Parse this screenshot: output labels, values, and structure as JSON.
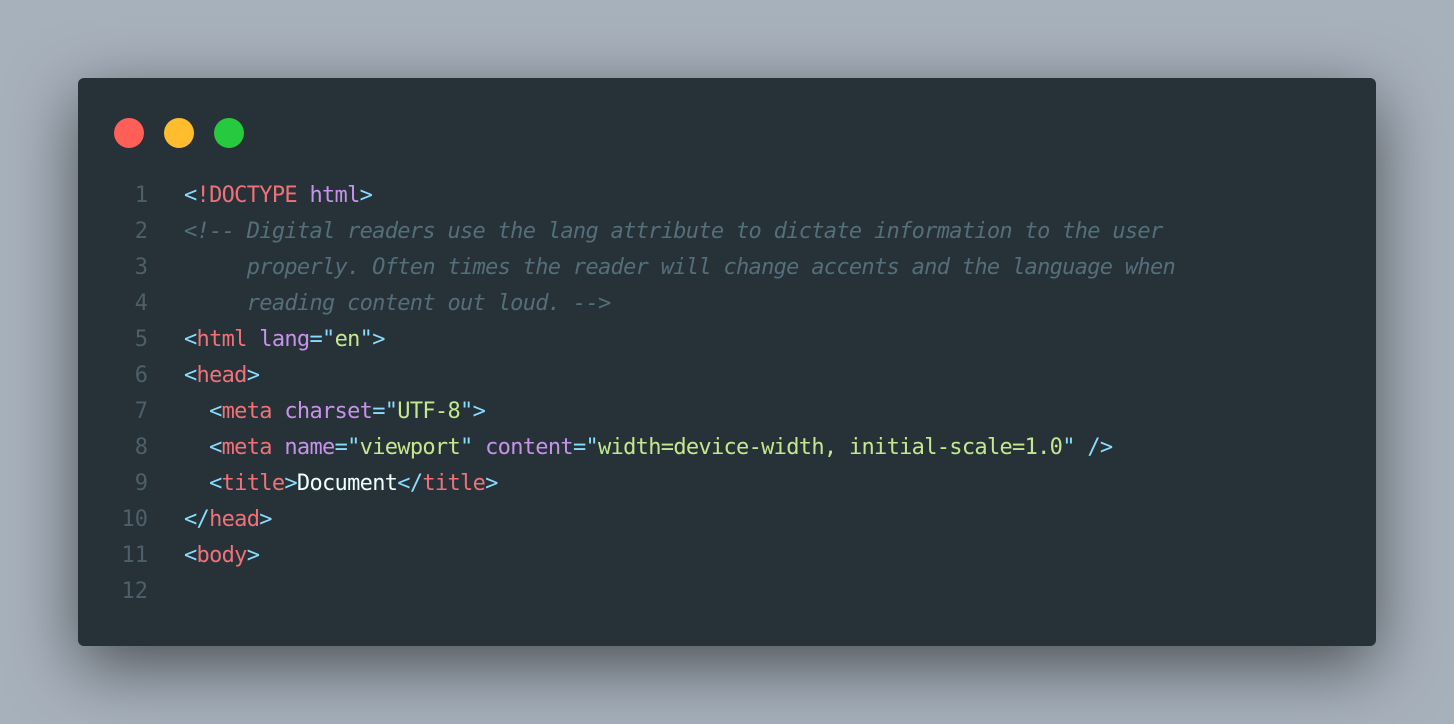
{
  "colors": {
    "background": "#a7b1bc",
    "window": "#263238",
    "close": "#ff5f56",
    "minimize": "#ffbd2e",
    "zoom": "#27c93f",
    "punctuation": "#89ddff",
    "tag": "#f07178",
    "attribute": "#c792ea",
    "string": "#c3e88d",
    "comment": "#546e7a",
    "text": "#eeffff"
  },
  "window_controls": [
    "close-button",
    "minimize-button",
    "zoom-button"
  ],
  "code": {
    "lines": [
      {
        "number": "1",
        "tokens": [
          {
            "type": "p",
            "text": "<"
          },
          {
            "type": "t",
            "text": "!DOCTYPE"
          },
          {
            "type": "w",
            "text": " "
          },
          {
            "type": "a",
            "text": "html"
          },
          {
            "type": "p",
            "text": ">"
          }
        ]
      },
      {
        "number": "2",
        "tokens": [
          {
            "type": "c",
            "text": "<!-- Digital readers use the lang attribute to dictate information to the user"
          }
        ]
      },
      {
        "number": "3",
        "tokens": [
          {
            "type": "c",
            "text": "     properly. Often times the reader will change accents and the language when"
          }
        ]
      },
      {
        "number": "4",
        "tokens": [
          {
            "type": "c",
            "text": "     reading content out loud. -->"
          }
        ]
      },
      {
        "number": "5",
        "tokens": [
          {
            "type": "p",
            "text": "<"
          },
          {
            "type": "t",
            "text": "html"
          },
          {
            "type": "w",
            "text": " "
          },
          {
            "type": "a",
            "text": "lang"
          },
          {
            "type": "p",
            "text": "=\""
          },
          {
            "type": "s",
            "text": "en"
          },
          {
            "type": "p",
            "text": "\">"
          }
        ]
      },
      {
        "number": "6",
        "tokens": [
          {
            "type": "p",
            "text": "<"
          },
          {
            "type": "t",
            "text": "head"
          },
          {
            "type": "p",
            "text": ">"
          }
        ]
      },
      {
        "number": "7",
        "tokens": [
          {
            "type": "w",
            "text": "  "
          },
          {
            "type": "p",
            "text": "<"
          },
          {
            "type": "t",
            "text": "meta"
          },
          {
            "type": "w",
            "text": " "
          },
          {
            "type": "a",
            "text": "charset"
          },
          {
            "type": "p",
            "text": "=\""
          },
          {
            "type": "s",
            "text": "UTF-8"
          },
          {
            "type": "p",
            "text": "\">"
          }
        ]
      },
      {
        "number": "8",
        "tokens": [
          {
            "type": "w",
            "text": "  "
          },
          {
            "type": "p",
            "text": "<"
          },
          {
            "type": "t",
            "text": "meta"
          },
          {
            "type": "w",
            "text": " "
          },
          {
            "type": "a",
            "text": "name"
          },
          {
            "type": "p",
            "text": "=\""
          },
          {
            "type": "s",
            "text": "viewport"
          },
          {
            "type": "p",
            "text": "\""
          },
          {
            "type": "w",
            "text": " "
          },
          {
            "type": "a",
            "text": "content"
          },
          {
            "type": "p",
            "text": "=\""
          },
          {
            "type": "s",
            "text": "width=device-width, initial-scale=1.0"
          },
          {
            "type": "p",
            "text": "\""
          },
          {
            "type": "w",
            "text": " "
          },
          {
            "type": "p",
            "text": "/>"
          }
        ]
      },
      {
        "number": "9",
        "tokens": [
          {
            "type": "w",
            "text": "  "
          },
          {
            "type": "p",
            "text": "<"
          },
          {
            "type": "t",
            "text": "title"
          },
          {
            "type": "p",
            "text": ">"
          },
          {
            "type": "w",
            "text": "Document"
          },
          {
            "type": "p",
            "text": "</"
          },
          {
            "type": "t",
            "text": "title"
          },
          {
            "type": "p",
            "text": ">"
          }
        ]
      },
      {
        "number": "10",
        "tokens": [
          {
            "type": "p",
            "text": "</"
          },
          {
            "type": "t",
            "text": "head"
          },
          {
            "type": "p",
            "text": ">"
          }
        ]
      },
      {
        "number": "11",
        "tokens": [
          {
            "type": "p",
            "text": "<"
          },
          {
            "type": "t",
            "text": "body"
          },
          {
            "type": "p",
            "text": ">"
          }
        ]
      },
      {
        "number": "12",
        "tokens": []
      }
    ]
  }
}
